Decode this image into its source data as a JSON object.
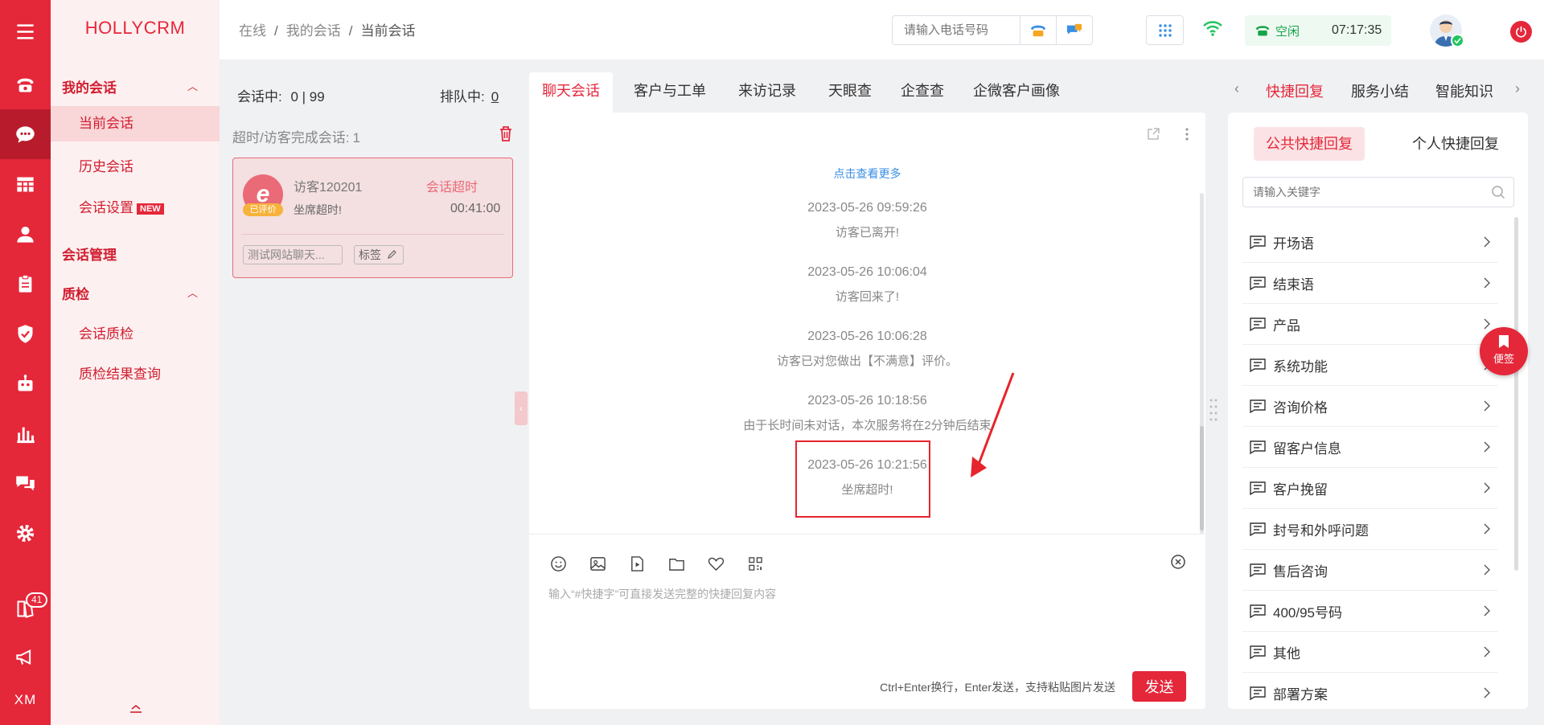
{
  "app": {
    "logo": "HOLLYCRM"
  },
  "rail": {
    "badge_count": "41",
    "bottom_label": "XM"
  },
  "nav": {
    "group1": "我的会话",
    "current_session": "当前会话",
    "history_session": "历史会话",
    "session_settings": "会话设置",
    "new_tag": "NEW",
    "session_manage": "会话管理",
    "qc_group": "质检",
    "session_qc": "会话质检",
    "qc_result": "质检结果查询"
  },
  "breadcrumb": [
    "在线",
    "我的会话",
    "当前会话"
  ],
  "topbar": {
    "phone_placeholder": "请输入电话号码",
    "status": "空闲",
    "time": "07:17:35"
  },
  "sessions": {
    "active_label": "会话中:",
    "active_value": "0 | 99",
    "queue_label": "排队中:",
    "queue_value": "0",
    "timeout_label": "超时/访客完成会话:",
    "timeout_count": "1",
    "card": {
      "avatar_letter": "e",
      "rated": "已评价",
      "visitor": "访客120201",
      "state": "会话超时",
      "message": "坐席超时!",
      "duration": "00:41:00",
      "tag_channel": "测试网站聊天...",
      "tag_label": "标签"
    }
  },
  "center_tabs": [
    "聊天会话",
    "客户与工单",
    "来访记录",
    "天眼查",
    "企查查",
    "企微客户画像"
  ],
  "chat": {
    "more": "点击查看更多",
    "messages": [
      {
        "time": "2023-05-26 09:59:26",
        "text": "访客已离开!"
      },
      {
        "time": "2023-05-26 10:06:04",
        "text": "访客回来了!"
      },
      {
        "time": "2023-05-26 10:06:28",
        "text": "访客已对您做出【不满意】评价。"
      },
      {
        "time": "2023-05-26 10:18:56",
        "text": "由于长时间未对话，本次服务将在2分钟后结束"
      },
      {
        "time": "2023-05-26 10:21:56",
        "text": "坐席超时!"
      }
    ],
    "input_placeholder": "输入“#快捷字”可直接发送完整的快捷回复内容",
    "hint": "Ctrl+Enter换行，Enter发送，支持粘贴图片发送",
    "send": "发送"
  },
  "right_tabs": [
    "快捷回复",
    "服务小结",
    "智能知识"
  ],
  "quick": {
    "public": "公共快捷回复",
    "personal": "个人快捷回复",
    "keyword_placeholder": "请输入关键字",
    "items": [
      "开场语",
      "结束语",
      "产品",
      "系统功能",
      "咨询价格",
      "留客户信息",
      "客户挽留",
      "封号和外呼问题",
      "售后咨询",
      "400/95号码",
      "其他",
      "部署方案"
    ]
  },
  "sticky": "便签",
  "colors": {
    "brand": "#e5273a",
    "nav_bg": "#fdf0f0",
    "status_green": "#16a34a",
    "link": "#3a8ee6"
  }
}
